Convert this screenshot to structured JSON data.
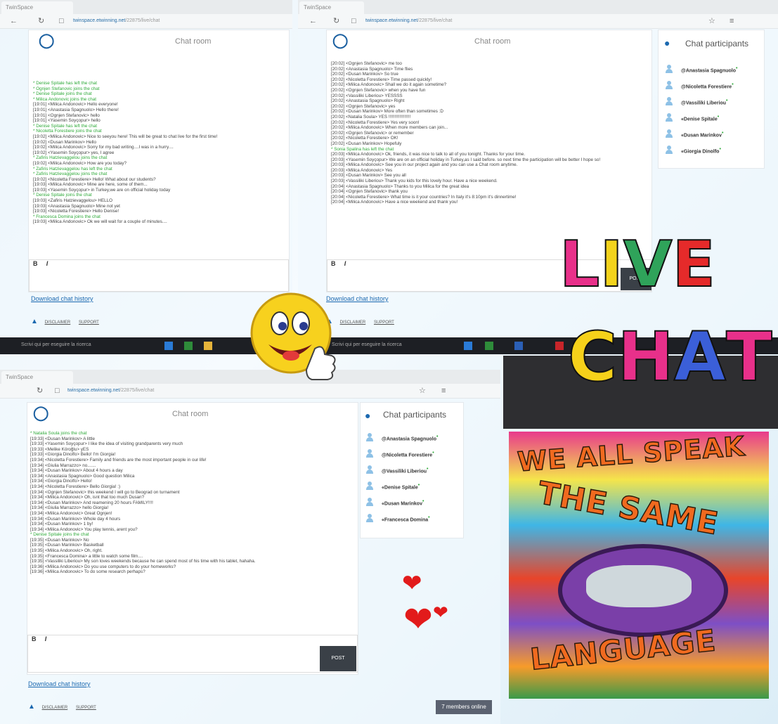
{
  "browser": {
    "tab_title": "TwinSpace",
    "url_host": "twinspace.etwinning.net",
    "url_path": "/22875/live/chat",
    "taskbar_search": "Scrivi qui per eseguire la ricerca"
  },
  "chat": {
    "room_title": "Chat room",
    "participants_title": "Chat participants",
    "format_bold": "B",
    "format_italic": "I",
    "post_label": "POST",
    "download_label": "Download chat history",
    "disclaimer_label": "DISCLAIMER",
    "support_label": "SUPPORT",
    "members_online": "7 members online"
  },
  "panel1_messages": [
    {
      "t": "* Denise Spitale has left the chat",
      "join": true
    },
    {
      "t": "* Ognjen Stefanovic joins the chat",
      "join": true
    },
    {
      "t": "* Denise Spitale joins the chat",
      "join": true
    },
    {
      "t": "* Milica Andonovic joins the chat",
      "join": true
    },
    {
      "t": "[19:01] <Milica Andonovic> Hello everyone!",
      "join": false
    },
    {
      "t": "[19:01] <Anastasia Spagnuolo> Hello there!",
      "join": false
    },
    {
      "t": "[19:01] <Ognjen Stefanovic> hello",
      "join": false
    },
    {
      "t": "[19:01] <Yasemin Soyçopur> hello",
      "join": false
    },
    {
      "t": "* Denise Spitale has left the chat",
      "join": true
    },
    {
      "t": "* Nicoletta Forestiere joins the chat",
      "join": true
    },
    {
      "t": "[19:02] <Milica Andonovic> Nice to seeyou here! This will be great to chat live for the first time!",
      "join": false
    },
    {
      "t": "[19:02] <Dusan Marinkov> Hello",
      "join": false
    },
    {
      "t": "[19:02] <Milica Andonovic> Sorry for my bad writing....I was in a hurry....",
      "join": false
    },
    {
      "t": "[19:02] <Yasemin Soyçopur> yes, I agree",
      "join": false
    },
    {
      "t": "* Zafiris Hatzievaggelou joins the chat",
      "join": true
    },
    {
      "t": "[19:02] <Milica Andonovic> How are you today?",
      "join": false
    },
    {
      "t": "* Zafiris Hatzievaggelou has left the chat",
      "join": true
    },
    {
      "t": "* Zafiris Hatzievaggelou joins the chat",
      "join": true
    },
    {
      "t": "[19:02] <Nicoletta Forestiere> Hello! What about our students?",
      "join": false
    },
    {
      "t": "[19:03] <Milica Andonovic> Mine are here, some of them...",
      "join": false
    },
    {
      "t": "[19:03] <Yasemin Soyçopur> in Turkey,we are on official holiday today",
      "join": false
    },
    {
      "t": "* Denise Spitale joins the chat",
      "join": true
    },
    {
      "t": "[19:03] <Zafiris Hatzievaggelou> HELLO",
      "join": false
    },
    {
      "t": "[19:03] <Anastasia Spagnuolo> Mine not yet",
      "join": false
    },
    {
      "t": "[19:03] <Nicoletta Forestiere> Hello Denise!",
      "join": false
    },
    {
      "t": "* Francesca Domina joins the chat",
      "join": true
    },
    {
      "t": "[19:03] <Milica Andonovic> Ok we will wait for a couple of minutes....",
      "join": false
    }
  ],
  "panel2_messages": [
    {
      "t": "[20:02] <Ognjen Stefanovic> me too",
      "join": false
    },
    {
      "t": "[20:02] <Anastasia Spagnuolo> Time flies",
      "join": false
    },
    {
      "t": "[20:02] <Dusan Marinkov> So true",
      "join": false
    },
    {
      "t": "[20:02] <Nicoletta Forestiere> Time passed quickly!",
      "join": false
    },
    {
      "t": "[20:02] <Milica Andonovic> Shall we do it again sometime?",
      "join": false
    },
    {
      "t": "[20:02] <Ognjen Stefanovic> when you have fun",
      "join": false
    },
    {
      "t": "[20:02] <Vassiliki Liberiou> YESSSS",
      "join": false
    },
    {
      "t": "[20:02] <Anastasia Spagnuolo> Right",
      "join": false
    },
    {
      "t": "[20:02] <Ognjen Stefanovic> yes",
      "join": false
    },
    {
      "t": "[20:02] <Dusan Marinkov> More often than sometimes :D",
      "join": false
    },
    {
      "t": "[20:02] <Natalia Soula> YES !!!!!!!!!!!!!!!!!!",
      "join": false
    },
    {
      "t": "[20:02] <Nicoletta Forestiere> Yes very soon!",
      "join": false
    },
    {
      "t": "[20:02] <Milica Andonovic> When more members can join...",
      "join": false
    },
    {
      "t": "[20:02] <Ognjen Stefanovic> or remember",
      "join": false
    },
    {
      "t": "[20:02] <Nicoletta Forestiere> OK!",
      "join": false
    },
    {
      "t": "[20:02] <Dusan Marinkov> Hopefuly",
      "join": false
    },
    {
      "t": "* Sonia Spalina has left the chat",
      "join": true
    },
    {
      "t": "[20:03] <Milica Andonovic> Ok, friends, it was nice to talk to all of you tonight. Thanks for your time.",
      "join": false
    },
    {
      "t": "[20:03] <Yasemin Soyçopur> We are on an official holiday in Turkey,as I said before. so next time the participation will be better I hope so!",
      "join": false
    },
    {
      "t": "[20:03] <Milica Andonovic> See you in our project again and you can use a Chat room anytime.",
      "join": false
    },
    {
      "t": "[20:03] <Milica Andonovic> Yes",
      "join": false
    },
    {
      "t": "[20:03] <Dusan Marinkov> See you all",
      "join": false
    },
    {
      "t": "[20:03] <Vassiliki Liberiou> Thank you kids for this lovely hour. Have a nice weekend.",
      "join": false
    },
    {
      "t": "[20:04] <Anastasia Spagnuolo> Thanks to you Milica for the great idea",
      "join": false
    },
    {
      "t": "[20:04] <Ognjen Stefanovic> thank you",
      "join": false
    },
    {
      "t": "[20:04] <Nicoletta Forestiere> What time is it your countries? In Italy it's 8:10pm it's dinnertime!",
      "join": false
    },
    {
      "t": "[20:04] <Milica Andonovic> Have a nice weekend and thank you!",
      "join": false
    }
  ],
  "panel3_messages": [
    {
      "t": "* Natalia Soula joins the chat",
      "join": true
    },
    {
      "t": "[19:33] <Dusan Marinkov> A little",
      "join": false
    },
    {
      "t": "[19:33] <Yasemin Soyçopur> I like the idea of visiting grandparents very much",
      "join": false
    },
    {
      "t": "[19:33] <Melike Köroğlu> yES",
      "join": false
    },
    {
      "t": "[19:33] <Giorgia Dinolfo> Bello! I'm Giorgia!",
      "join": false
    },
    {
      "t": "[19:34] <Nicoletta Forestiere> Family and friends are the most important people in our life!",
      "join": false
    },
    {
      "t": "[19:34] <Giulia Marrazzo> no.......",
      "join": false
    },
    {
      "t": "[19:34] <Dusan Marinkov> About 4 hours a day",
      "join": false
    },
    {
      "t": "[19:34] <Anastasia Spagnuolo> Good question Milica",
      "join": false
    },
    {
      "t": "[19:34] <Giorgia Dinolfo> Hello!",
      "join": false
    },
    {
      "t": "[19:34] <Nicoletta Forestiere> Bello Giorgia! :)",
      "join": false
    },
    {
      "t": "[19:34] <Ognjen Stefanovic> this weekend I will go to Beograd on turnament",
      "join": false
    },
    {
      "t": "[19:34] <Milica Andonovic> Oh, isnt that too much Dusan?",
      "join": false
    },
    {
      "t": "[19:34] <Dusan Marinkov> And reamening 20 hours FAMILY!!!!",
      "join": false
    },
    {
      "t": "[19:34] <Giulia Marrazzo> hello Giorgia!",
      "join": false
    },
    {
      "t": "[19:34] <Milica Andonovic> Great Ognjen!",
      "join": false
    },
    {
      "t": "[19:34] <Dusan Marinkov> Whole day 4 hours",
      "join": false
    },
    {
      "t": "[19:34] <Dusan Marinkov> 1 by!",
      "join": false
    },
    {
      "t": "[19:34] <Milica Andonovic> You play tennis, arent you?",
      "join": false
    },
    {
      "t": "* Denise Spitale joins the chat",
      "join": true
    },
    {
      "t": "[19:35] <Dusan Marinkov> No",
      "join": false
    },
    {
      "t": "[19:35] <Dusan Marinkov> Basketball",
      "join": false
    },
    {
      "t": "[19:35] <Milica Andonovic> Oh, right.",
      "join": false
    },
    {
      "t": "[19:35] <Francesca Domina> a little to watch some film....",
      "join": false
    },
    {
      "t": "[19:35] <Vassiliki Liberiou> My son loves weekends because he can spend most of his time with his tablet, hahaha.",
      "join": false
    },
    {
      "t": "[19:36] <Milica Andonovic> Do you use computers to do your homeworks?",
      "join": false
    },
    {
      "t": "[19:36] <Milica Andonovic> To do some research perhaps?",
      "join": false
    }
  ],
  "participants_top": [
    "@Anastasia Spagnuolo",
    "@Nicoletta Forestiere",
    "@Vassiliki Liberiou",
    "«Denise Spitale",
    "«Dusan Marinkov",
    "«Giorgia Dinolfo"
  ],
  "participants_bottom": [
    "@Anastasia Spagnuolo",
    "@Nicoletta Forestiere",
    "@Vassiliki Liberiou",
    "«Denise Spitale",
    "«Dusan Marinkov",
    "«Francesca Domina"
  ],
  "decor": {
    "live_word": "LIVE",
    "chat_word": "CHAT",
    "live_colors": [
      "#e8308a",
      "#f3d31c",
      "#2fa35a",
      "#e52a2a"
    ],
    "chat_colors": [
      "#f6d11a",
      "#e8308a",
      "#3b5fd8",
      "#e8308a"
    ],
    "poster_lines": [
      "WE ALL SPEAK",
      "THE SAME",
      "LANGUAGE"
    ],
    "accent": "#1c69b0",
    "join_color": "#2faa3a"
  },
  "icons": [
    "home-icon",
    "chat-bubble-icon",
    "user-icon",
    "star-icon",
    "refresh-icon",
    "lock-icon",
    "heart-icon",
    "smiley-icon"
  ]
}
